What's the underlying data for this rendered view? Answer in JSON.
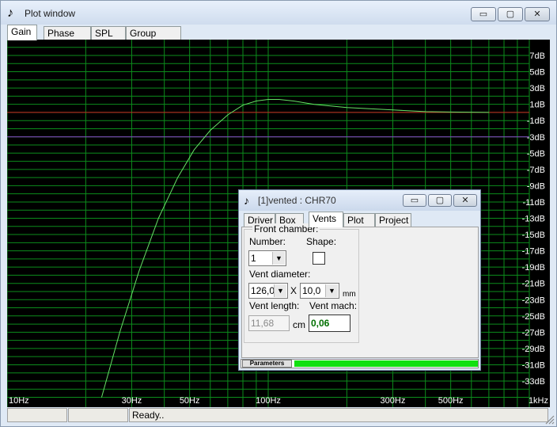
{
  "window": {
    "title": "Plot window",
    "controls": {
      "minimize": "▭",
      "maximize": "▢",
      "close": "✕"
    }
  },
  "tabs": [
    {
      "label": "Gain",
      "active": true
    },
    {
      "label": "Phase plot",
      "active": false
    },
    {
      "label": "SPL",
      "active": false
    },
    {
      "label": "Group delay",
      "active": false
    }
  ],
  "status": {
    "pane1": "",
    "pane2": "",
    "message": "Ready.."
  },
  "colors": {
    "grid": "#0c8c1c",
    "curve": "#66e066",
    "ref_red": "#cc2222",
    "ref_purple": "#8844cc",
    "progress": "#10e010"
  },
  "chart_data": {
    "type": "line",
    "x_ticks": [
      "10Hz",
      "30Hz",
      "50Hz",
      "100Hz",
      "300Hz",
      "500Hz",
      "1kHz"
    ],
    "x_tick_values": [
      10,
      30,
      50,
      100,
      300,
      500,
      1000
    ],
    "xlim": [
      10,
      1000
    ],
    "x_scale": "log",
    "y_ticks": [
      "7dB",
      "5dB",
      "3dB",
      "1dB",
      "-1dB",
      "-3dB",
      "-5dB",
      "-7dB",
      "-9dB",
      "-11dB",
      "-13dB",
      "-15dB",
      "-17dB",
      "-19dB",
      "-21dB",
      "-23dB",
      "-25dB",
      "-27dB",
      "-29dB",
      "-31dB",
      "-33dB"
    ],
    "y_tick_values": [
      7,
      5,
      3,
      1,
      -1,
      -3,
      -5,
      -7,
      -9,
      -11,
      -13,
      -15,
      -17,
      -19,
      -21,
      -23,
      -25,
      -27,
      -29,
      -31,
      -33
    ],
    "ylim": [
      -35,
      8
    ],
    "reference_lines": [
      {
        "y": 0,
        "color": "red"
      },
      {
        "y": -3,
        "color": "purple"
      }
    ],
    "series": [
      {
        "color": "green",
        "x": [
          23,
          27,
          32,
          38,
          45,
          52,
          60,
          70,
          80,
          90,
          100,
          110,
          125,
          150,
          200,
          300,
          400,
          500,
          700
        ],
        "y": [
          -35,
          -27,
          -19.5,
          -13,
          -8,
          -4.6,
          -2.2,
          -0.3,
          0.9,
          1.4,
          1.6,
          1.6,
          1.4,
          1.0,
          0.6,
          0.3,
          0.1,
          0.05,
          0
        ]
      }
    ],
    "grid": true
  },
  "vent_dialog": {
    "title": "[1]vented : CHR70",
    "tabs": [
      {
        "label": "Driver",
        "active": false
      },
      {
        "label": "Box",
        "active": false
      },
      {
        "label": "Vents",
        "active": true
      },
      {
        "label": "Plot",
        "active": false
      },
      {
        "label": "Project",
        "active": false
      }
    ],
    "group_title": "Front chamber:",
    "number_label": "Number:",
    "number_value": "1",
    "shape_label": "Shape:",
    "vent_diameter_label": "Vent diameter:",
    "diameter_value": "126,0",
    "times": "X",
    "diameter2_value": "10,0",
    "diameter_unit": "mm",
    "vent_length_label": "Vent length:",
    "vent_length_value": "11,68",
    "length_unit": "cm",
    "vent_mach_label": "Vent mach:",
    "vent_mach_value": "0,06",
    "progress_label": "Parameters",
    "progress": 1.0
  }
}
